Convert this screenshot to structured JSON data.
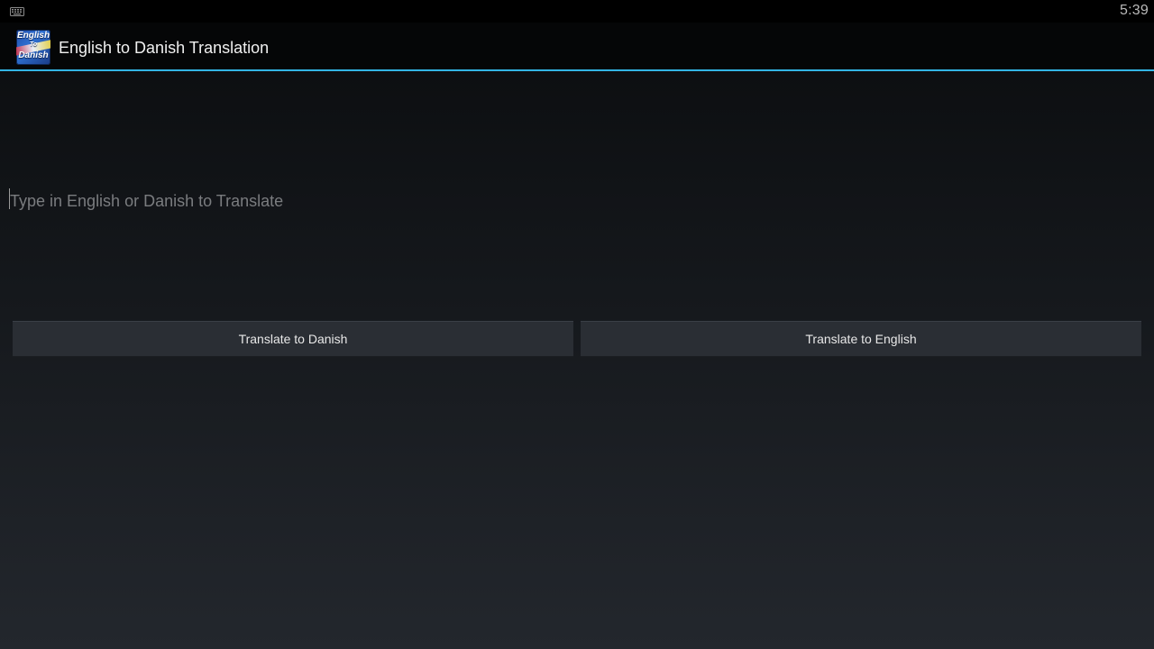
{
  "status_bar": {
    "left_icon": "keyboard-icon",
    "time": "5:39"
  },
  "action_bar": {
    "app_icon": {
      "name": "app-logo-icon",
      "line1": "English",
      "line2": "To",
      "line3": "Danish"
    },
    "title": "English to Danish Translation",
    "accent_color": "#33b5e5"
  },
  "translate_input": {
    "value": "",
    "placeholder": "Type in English or Danish to Translate"
  },
  "buttons": {
    "to_danish": "Translate to Danish",
    "to_english": "Translate to English"
  }
}
